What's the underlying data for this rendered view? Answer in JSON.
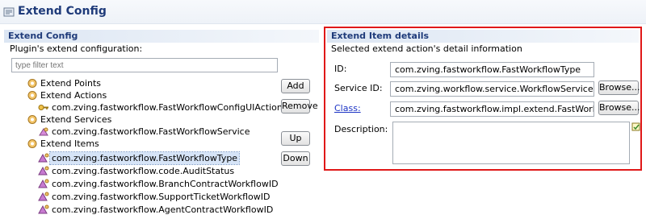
{
  "header": {
    "title": "Extend Config",
    "icon": "extend-config-icon"
  },
  "left": {
    "section_title": "Extend Config",
    "subtitle": "Plugin's extend configuration:",
    "filter_placeholder": "type filter text",
    "tree": {
      "extend_points": "Extend Points",
      "extend_actions": "Extend Actions",
      "action_item": "com.zving.fastworkflow.FastWorkflowConfigUIAction",
      "extend_services": "Extend Services",
      "service_item": "com.zving.fastworkflow.FastWorkflowService",
      "extend_items": "Extend Items",
      "items": [
        "com.zving.fastworkflow.FastWorkflowType",
        "com.zving.fastworkflow.code.AuditStatus",
        "com.zving.fastworkflow.BranchContractWorkflowID",
        "com.zving.fastworkflow.SupportTicketWorkflowID",
        "com.zving.fastworkflow.AgentContractWorkflowID"
      ]
    },
    "buttons": {
      "add": "Add",
      "remove": "Remove",
      "up": "Up",
      "down": "Down"
    }
  },
  "right": {
    "section_title": "Extend Item details",
    "subtitle": "Selected extend action's detail information",
    "id_label": "ID:",
    "id_value": "com.zving.fastworkflow.FastWorkflowType",
    "service_label": "Service ID:",
    "service_value": "com.zving.workflow.service.WorkflowService",
    "class_label": "Class:",
    "class_value": "com.zving.fastworkflow.impl.extend.FastWorkflowType",
    "description_label": "Description:",
    "browse": "Browse...",
    "highlight_color": "#e01818"
  }
}
